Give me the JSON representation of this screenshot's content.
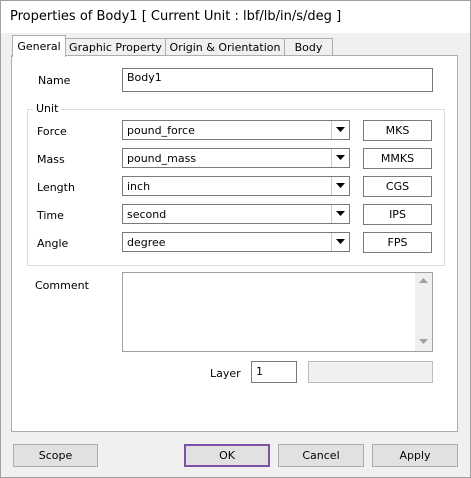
{
  "window": {
    "title": "Properties of Body1 [ Current Unit : lbf/lb/in/s/deg ]"
  },
  "tabs": [
    {
      "label": "General"
    },
    {
      "label": "Graphic Property"
    },
    {
      "label": "Origin & Orientation"
    },
    {
      "label": "Body"
    }
  ],
  "general": {
    "name_label": "Name",
    "name_value": "Body1",
    "unit_group_title": "Unit",
    "units": [
      {
        "label": "Force",
        "value": "pound_force",
        "preset": "MKS"
      },
      {
        "label": "Mass",
        "value": "pound_mass",
        "preset": "MMKS"
      },
      {
        "label": "Length",
        "value": "inch",
        "preset": "CGS"
      },
      {
        "label": "Time",
        "value": "second",
        "preset": "IPS"
      },
      {
        "label": "Angle",
        "value": "degree",
        "preset": "FPS"
      }
    ],
    "comment_label": "Comment",
    "comment_value": "",
    "layer_label": "Layer",
    "layer_value": "1"
  },
  "footer": {
    "scope": "Scope",
    "ok": "OK",
    "cancel": "Cancel",
    "apply": "Apply"
  }
}
